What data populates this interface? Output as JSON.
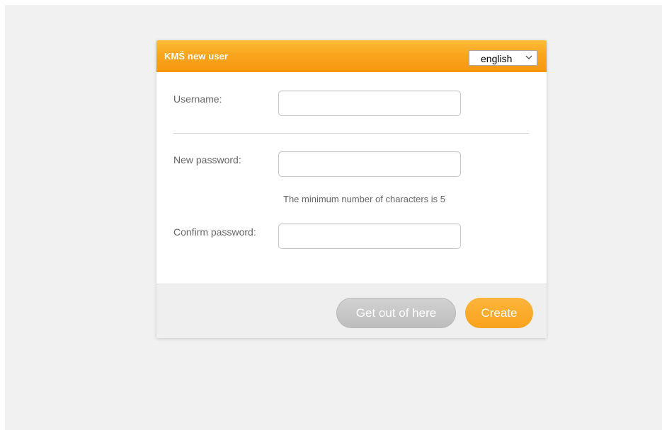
{
  "dialog": {
    "title": "KMŠ new user",
    "language": {
      "selected": "english"
    }
  },
  "form": {
    "username_label": "Username:",
    "username_value": "",
    "new_password_label": "New password:",
    "new_password_value": "",
    "password_hint": "The minimum number of characters is 5",
    "confirm_password_label": "Confirm password:",
    "confirm_password_value": ""
  },
  "footer": {
    "cancel_label": "Get out of here",
    "create_label": "Create"
  },
  "colors": {
    "accent": "#f9a51e",
    "page_background": "#f1f1f1",
    "cancel_button": "#c6c6c6"
  },
  "icons": {
    "language_dropdown": "chevron-down-icon"
  }
}
